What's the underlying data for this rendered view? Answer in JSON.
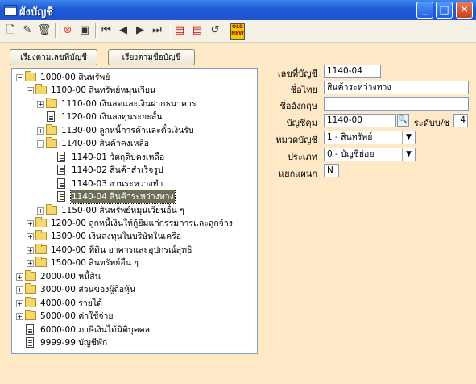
{
  "window": {
    "title": "ผังบัญชี",
    "minimize": "_",
    "maximize": "□",
    "close": "✕"
  },
  "toolbar": {
    "old_new": "OLD NEW"
  },
  "buttons": {
    "sort_by_code": "เรียงตามเลขที่บัญชี",
    "sort_by_name": "เรียงตามชื่อบัญชี"
  },
  "tree": [
    {
      "expander": "−",
      "kind": "folder",
      "label": "1000-00 สินทรัพย์"
    },
    {
      "expander": "−",
      "kind": "folder",
      "label": "1100-00 สินทรัพย์หมุนเวียน"
    },
    {
      "expander": "+",
      "kind": "folder",
      "label": "1110-00 เงินสดและเงินฝากธนาคาร"
    },
    {
      "expander": "",
      "kind": "doc",
      "label": "1120-00 เงินลงทุนระยะสั้น"
    },
    {
      "expander": "+",
      "kind": "folder",
      "label": "1130-00 ลูกหนี้การค้าและตั๋วเงินรับ"
    },
    {
      "expander": "−",
      "kind": "folder",
      "label": "1140-00 สินค้าคงเหลือ"
    },
    {
      "expander": "",
      "kind": "doc",
      "label": "1140-01 วัตถุดิบคงเหลือ"
    },
    {
      "expander": "",
      "kind": "doc",
      "label": "1140-02 สินค้าสำเร็จรูป"
    },
    {
      "expander": "",
      "kind": "doc",
      "label": "1140-03 งานระหว่างทำ"
    },
    {
      "expander": "",
      "kind": "doc",
      "label": "1140-04 สินค้าระหว่างทาง",
      "selected": true
    },
    {
      "expander": "+",
      "kind": "folder",
      "label": "1150-00 สินทรัพย์หมุนเวียนอื่น ๆ"
    },
    {
      "expander": "+",
      "kind": "folder",
      "label": "1200-00 ลูกหนี้เงินให้กู้ยืมแก่กรรมการและลูกจ้าง"
    },
    {
      "expander": "+",
      "kind": "folder",
      "label": "1300-00 เงินลงทุนในบริษัทในเครือ"
    },
    {
      "expander": "+",
      "kind": "folder",
      "label": "1400-00 ที่ดิน อาคารและอุปกรณ์สุทธิ"
    },
    {
      "expander": "+",
      "kind": "folder",
      "label": "1500-00 สินทรัพย์อื่น ๆ"
    },
    {
      "expander": "+",
      "kind": "folder",
      "label": "2000-00 หนี้สิน"
    },
    {
      "expander": "+",
      "kind": "folder",
      "label": "3000-00 ส่วนของผู้ถือหุ้น"
    },
    {
      "expander": "+",
      "kind": "folder",
      "label": "4000-00 รายได้"
    },
    {
      "expander": "+",
      "kind": "folder",
      "label": "5000-00 ค่าใช้จ่าย"
    },
    {
      "expander": "",
      "kind": "doc",
      "label": "6000-00 ภาษีเงินได้นิติบุคคล"
    },
    {
      "expander": "",
      "kind": "doc",
      "label": "9999-99 บัญชีพัก"
    }
  ],
  "form": {
    "account_no_label": "เลขที่บัญชี",
    "account_no": "1140-04",
    "thai_name_label": "ชื่อไทย",
    "thai_name": "สินค้าระหว่างทาง",
    "english_name_label": "ชื่ออังกฤษ",
    "english_name": "",
    "parent_label": "บัญชีคุม",
    "parent": "1140-00",
    "level_label": "ระดับบ/ช",
    "level": "4",
    "category_label": "หมวดบัญชี",
    "category": "1 - สินทรัพย์",
    "type_label": "ประเภท",
    "type": "0 - บัญชีย่อย",
    "dept_label": "แยกแผนก",
    "dept": "N"
  }
}
